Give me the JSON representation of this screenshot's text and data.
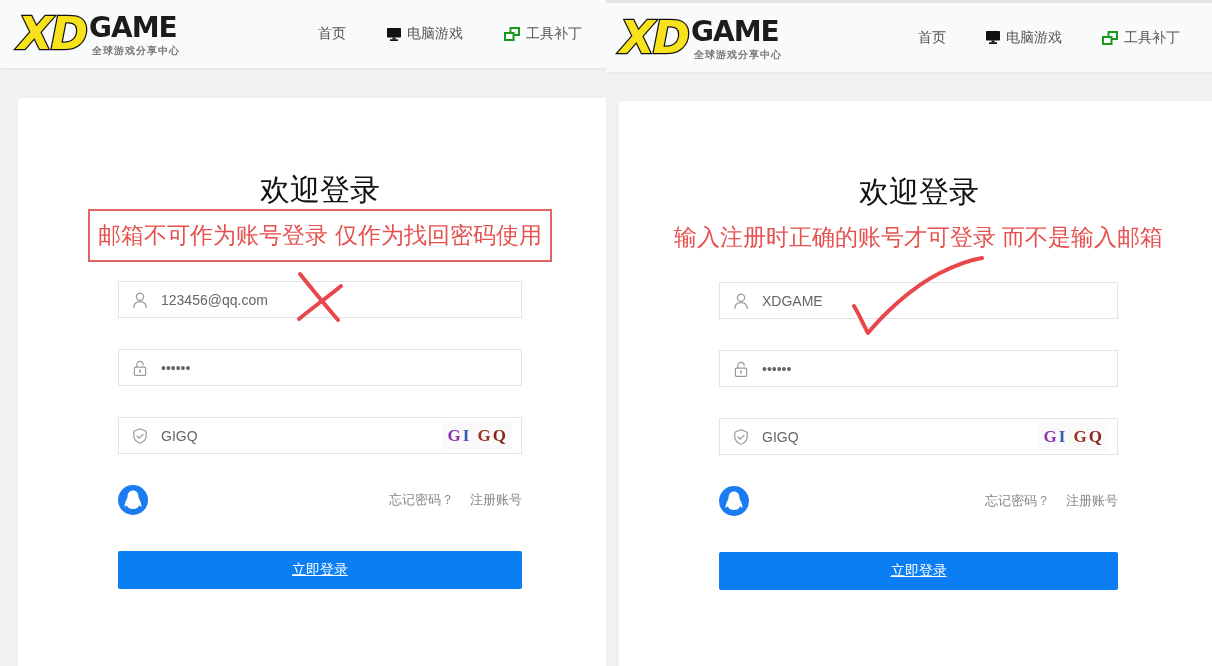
{
  "panels": [
    {
      "header": {
        "logo": {
          "mark": "XD",
          "word": "GAME",
          "tagline": "全球游戏分享中心"
        },
        "nav": [
          {
            "kind": "plain",
            "label": "首页"
          },
          {
            "kind": "pc",
            "label": "电脑游戏"
          },
          {
            "kind": "tools",
            "label": "工具补丁"
          }
        ]
      },
      "login": {
        "title": "欢迎登录",
        "note": {
          "text": "邮箱不可作为账号登录 仅作为找回密码使用",
          "boxed": true
        },
        "crossed": true,
        "ticked": false,
        "fields": [
          {
            "kind": "account",
            "value": "123456@qq.com"
          },
          {
            "kind": "password",
            "value": "••••••"
          },
          {
            "kind": "captcha",
            "value": "GIGQ",
            "code": "GI GQ"
          }
        ],
        "links": [
          "忘记密码？",
          "注册账号"
        ],
        "submit": "立即登录"
      }
    },
    {
      "header": {
        "logo": {
          "mark": "XD",
          "word": "GAME",
          "tagline": "全球游戏分享中心"
        },
        "nav": [
          {
            "kind": "plain",
            "label": "首页"
          },
          {
            "kind": "pc",
            "label": "电脑游戏"
          },
          {
            "kind": "tools",
            "label": "工具补丁"
          }
        ]
      },
      "login": {
        "title": "欢迎登录",
        "note": {
          "text": "输入注册时正确的账号才可登录 而不是输入邮箱",
          "boxed": false
        },
        "crossed": false,
        "ticked": true,
        "fields": [
          {
            "kind": "account",
            "value": "XDGAME"
          },
          {
            "kind": "password",
            "value": "••••••"
          },
          {
            "kind": "captcha",
            "value": "GIGQ",
            "code": "GI GQ"
          }
        ],
        "links": [
          "忘记密码？",
          "注册账号"
        ],
        "submit": "立即登录"
      }
    }
  ]
}
